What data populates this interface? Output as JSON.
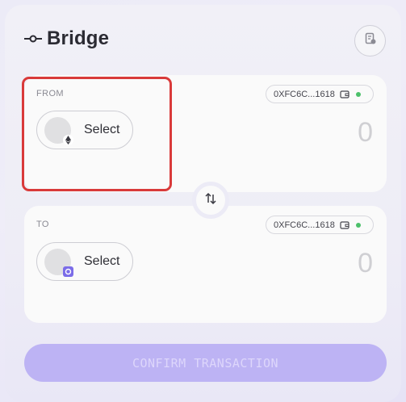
{
  "header": {
    "title": "Bridge",
    "icon": "bridge-icon",
    "history_icon": "history-icon"
  },
  "from_panel": {
    "label": "FROM",
    "address": "0XFC6C...1618",
    "wallet_icon": "wallet-icon",
    "status": "connected",
    "select_label": "Select",
    "token_badge_icon": "ethereum-icon",
    "amount": "0"
  },
  "to_panel": {
    "label": "TO",
    "address": "0XFC6C...1618",
    "wallet_icon": "wallet-icon",
    "status": "connected",
    "select_label": "Select",
    "token_badge_icon": "chain-icon",
    "amount": "0"
  },
  "swap": {
    "icon": "swap-arrows-icon"
  },
  "confirm": {
    "label": "CONFIRM TRANSACTION"
  },
  "colors": {
    "accent": "#bdb3f4",
    "highlight": "#d93a3a",
    "status_dot": "#4cc06a",
    "chain_badge": "#7b6ce8"
  }
}
